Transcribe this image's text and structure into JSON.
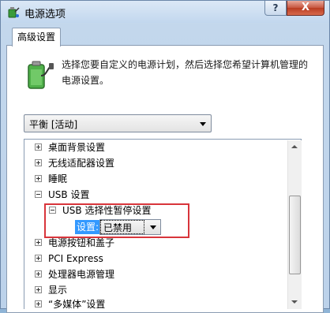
{
  "window": {
    "title": "电源选项",
    "help_label": "?",
    "close_label": "X"
  },
  "tab": {
    "label": "高级设置"
  },
  "description": "选择您要自定义的电源计划，然后选择您希望计算机管理的电源设置。",
  "plan_select": {
    "value": "平衡 [活动]"
  },
  "tree": {
    "items": [
      {
        "label": "桌面背景设置"
      },
      {
        "label": "无线适配器设置"
      },
      {
        "label": "睡眠"
      },
      {
        "label": "USB 设置"
      },
      {
        "label": "USB 选择性暂停设置"
      },
      {
        "label": "电源按钮和盖子"
      },
      {
        "label": "PCI Express"
      },
      {
        "label": "处理器电源管理"
      },
      {
        "label": "显示"
      },
      {
        "label": "“多媒体”设置"
      }
    ],
    "setting": {
      "label": "设置:",
      "value": "已禁用"
    }
  },
  "colors": {
    "highlight_box": "#d8353b",
    "selection": "#3399ff"
  }
}
